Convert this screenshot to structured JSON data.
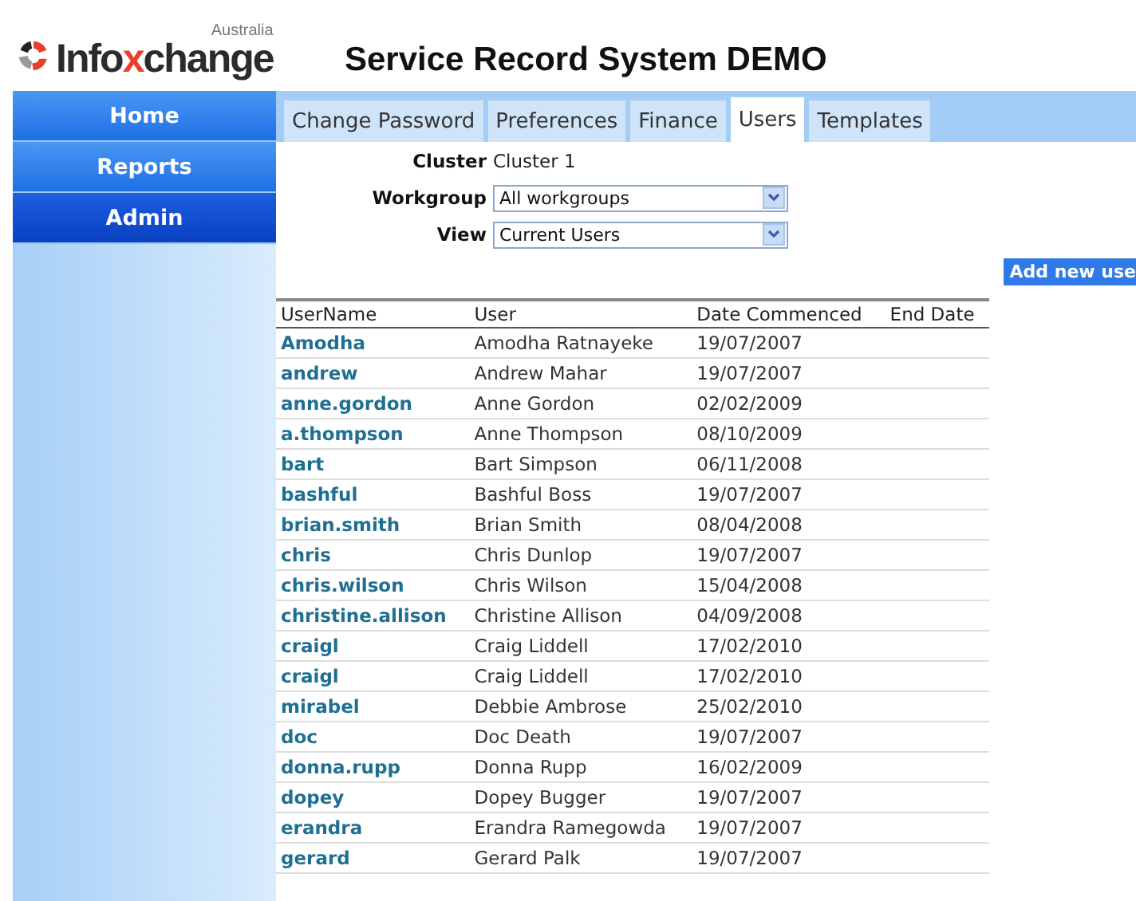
{
  "logo": {
    "region": "Australia",
    "before": "Info",
    "accent": "x",
    "after": "change"
  },
  "page_title": "Service Record System DEMO",
  "nav": [
    {
      "label": "Home",
      "selected": false
    },
    {
      "label": "Reports",
      "selected": false
    },
    {
      "label": "Admin",
      "selected": true
    }
  ],
  "tabs": [
    {
      "label": "Change Password",
      "selected": false
    },
    {
      "label": "Preferences",
      "selected": false
    },
    {
      "label": "Finance",
      "selected": false
    },
    {
      "label": "Users",
      "selected": true
    },
    {
      "label": "Templates",
      "selected": false
    }
  ],
  "form": [
    {
      "kind": "text",
      "label": "Cluster",
      "value": "Cluster 1"
    },
    {
      "kind": "select",
      "label": "Workgroup",
      "value": "All workgroups"
    },
    {
      "kind": "select",
      "label": "View",
      "value": "Current Users"
    }
  ],
  "add_button": "Add new use",
  "table": {
    "columns": [
      "UserName",
      "User",
      "Date Commenced",
      "End Date"
    ],
    "rows": [
      [
        "Amodha",
        "Amodha Ratnayeke",
        "19/07/2007"
      ],
      [
        "andrew",
        "Andrew Mahar",
        "19/07/2007"
      ],
      [
        "anne.gordon",
        "Anne Gordon",
        "02/02/2009"
      ],
      [
        "a.thompson",
        "Anne Thompson",
        "08/10/2009"
      ],
      [
        "bart",
        "Bart Simpson",
        "06/11/2008"
      ],
      [
        "bashful",
        "Bashful Boss",
        "19/07/2007"
      ],
      [
        "brian.smith",
        "Brian Smith",
        "08/04/2008"
      ],
      [
        "chris",
        "Chris Dunlop",
        "19/07/2007"
      ],
      [
        "chris.wilson",
        "Chris Wilson",
        "15/04/2008"
      ],
      [
        "christine.allison",
        "Christine Allison",
        "04/09/2008"
      ],
      [
        "craigl",
        "Craig Liddell",
        "17/02/2010"
      ],
      [
        "craigl",
        "Craig Liddell",
        "17/02/2010"
      ],
      [
        "mirabel",
        "Debbie Ambrose",
        "25/02/2010"
      ],
      [
        "doc",
        "Doc Death",
        "19/07/2007"
      ],
      [
        "donna.rupp",
        "Donna Rupp",
        "16/02/2009"
      ],
      [
        "dopey",
        "Dopey Bugger",
        "19/07/2007"
      ],
      [
        "erandra",
        "Erandra Ramegowda",
        "19/07/2007"
      ],
      [
        "gerard",
        "Gerard Palk",
        "19/07/2007"
      ]
    ]
  }
}
